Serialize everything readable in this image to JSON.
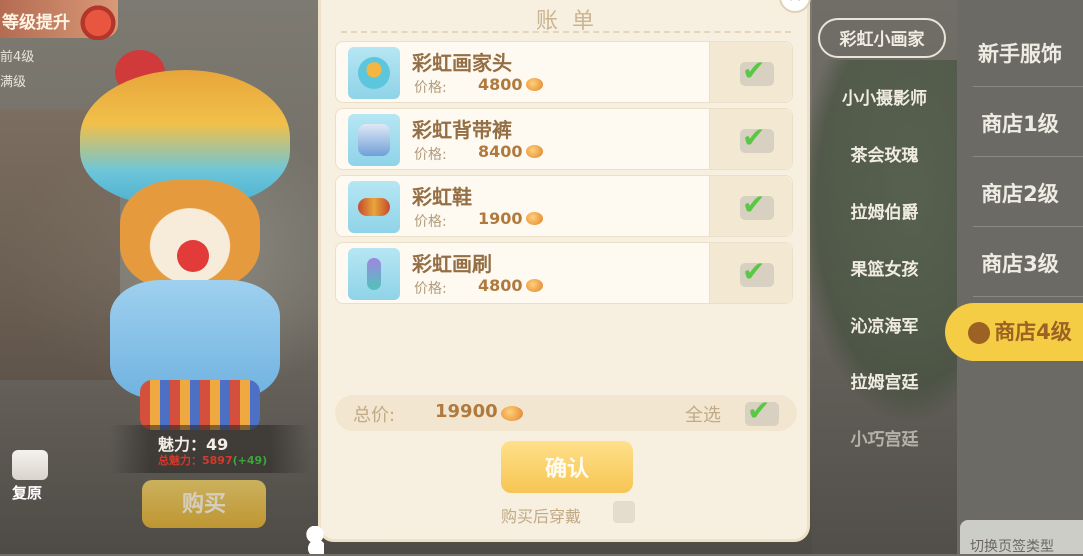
{
  "level_panel": {
    "title": "等级提升",
    "current_line": "前4级",
    "max_line": "满级"
  },
  "character": {
    "charm_text": "魅力：49",
    "total_charm_text": "总魅力：5897",
    "total_charm_bonus": "(+49)",
    "restore_label": "复原",
    "buy_label": "购买"
  },
  "bill": {
    "title": "账单",
    "price_label": "价格:",
    "items": [
      {
        "name": "彩虹画家头",
        "price": "4800",
        "checked": true,
        "icon": "hat-icon"
      },
      {
        "name": "彩虹背带裤",
        "price": "8400",
        "checked": true,
        "icon": "overalls-icon"
      },
      {
        "name": "彩虹鞋",
        "price": "1900",
        "checked": true,
        "icon": "shoes-icon"
      },
      {
        "name": "彩虹画刷",
        "price": "4800",
        "checked": true,
        "icon": "paintbrush-icon"
      }
    ],
    "total_label": "总价:",
    "total_value": "19900",
    "select_all_label": "全选",
    "confirm_label": "确认",
    "wear_after_buy_label": "购买后穿戴"
  },
  "outfit_sets": [
    {
      "label": "彩虹小画家",
      "active": true
    },
    {
      "label": "小小摄影师",
      "active": false
    },
    {
      "label": "茶会玫瑰",
      "active": false
    },
    {
      "label": "拉姆伯爵",
      "active": false
    },
    {
      "label": "果篮女孩",
      "active": false
    },
    {
      "label": "沁凉海军",
      "active": false
    },
    {
      "label": "拉姆宫廷",
      "active": false
    },
    {
      "label": "小巧宫廷",
      "active": false
    }
  ],
  "shop_tabs": [
    {
      "label": "新手服饰",
      "active": false
    },
    {
      "label": "商店1级",
      "active": false
    },
    {
      "label": "商店2级",
      "active": false
    },
    {
      "label": "商店3级",
      "active": false
    },
    {
      "label": "商店4级",
      "active": true
    }
  ],
  "switch_tip": "切换页签类型",
  "colors": {
    "accent_yellow": "#f4cd45",
    "check_green": "#5bc746",
    "price_brown": "#b07a3e",
    "charm_red": "#d23a2c"
  }
}
